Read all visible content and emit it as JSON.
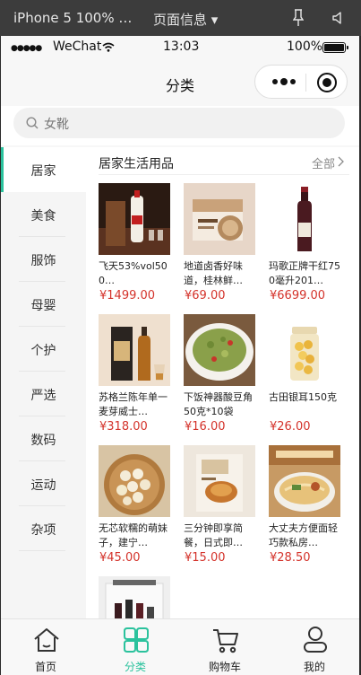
{
  "devtools": {
    "device": "iPhone 5 100% …",
    "page_info": "页面信息 ▾"
  },
  "status_bar": {
    "signal": "●●●●●",
    "carrier": "WeChat",
    "time": "13:03",
    "battery": "100%"
  },
  "navbar": {
    "title": "分类"
  },
  "search": {
    "placeholder": "女靴"
  },
  "sidebar": {
    "items": [
      {
        "label": "居家",
        "active": true
      },
      {
        "label": "美食"
      },
      {
        "label": "服饰"
      },
      {
        "label": "母婴"
      },
      {
        "label": "个护"
      },
      {
        "label": "严选"
      },
      {
        "label": "数码"
      },
      {
        "label": "运动"
      },
      {
        "label": "杂项"
      }
    ]
  },
  "section": {
    "title": "居家生活用品",
    "all_label": "全部"
  },
  "products": [
    {
      "name": "飞天53%vol500…",
      "price": "¥1499.00",
      "image": "moutai-bottle"
    },
    {
      "name": "地道卤香好味道，桂林鲜…",
      "price": "¥69.00",
      "image": "guilin-noodle-box"
    },
    {
      "name": "玛歌正牌干红750毫升201…",
      "price": "¥6699.00",
      "image": "red-wine-bottle"
    },
    {
      "name": "苏格兰陈年单一麦芽威士…",
      "price": "¥318.00",
      "image": "scotch-whisky"
    },
    {
      "name": "下饭神器酸豆角50克*10袋",
      "price": "¥16.00",
      "image": "pickled-beans-bowl"
    },
    {
      "name": "古田银耳150克",
      "price": "¥26.00",
      "image": "white-fungus-jar"
    },
    {
      "name": "无芯软糯的萌妹子，建宁…",
      "price": "¥45.00",
      "image": "lotus-seeds"
    },
    {
      "name": "三分钟即享简餐，日式即…",
      "price": "¥15.00",
      "image": "instant-meal-box"
    },
    {
      "name": "大丈夫方便面轻巧款私房…",
      "price": "¥28.50",
      "image": "ramen-bowl"
    },
    {
      "name": "",
      "price": "",
      "image": "wine-gift-box"
    }
  ],
  "tabbar": {
    "items": [
      {
        "label": "首页",
        "icon": "home-icon"
      },
      {
        "label": "分类",
        "icon": "category-icon",
        "active": true
      },
      {
        "label": "购物车",
        "icon": "cart-icon"
      },
      {
        "label": "我的",
        "icon": "profile-icon"
      }
    ]
  },
  "colors": {
    "accent": "#2bc29d",
    "price": "#d4332b"
  }
}
